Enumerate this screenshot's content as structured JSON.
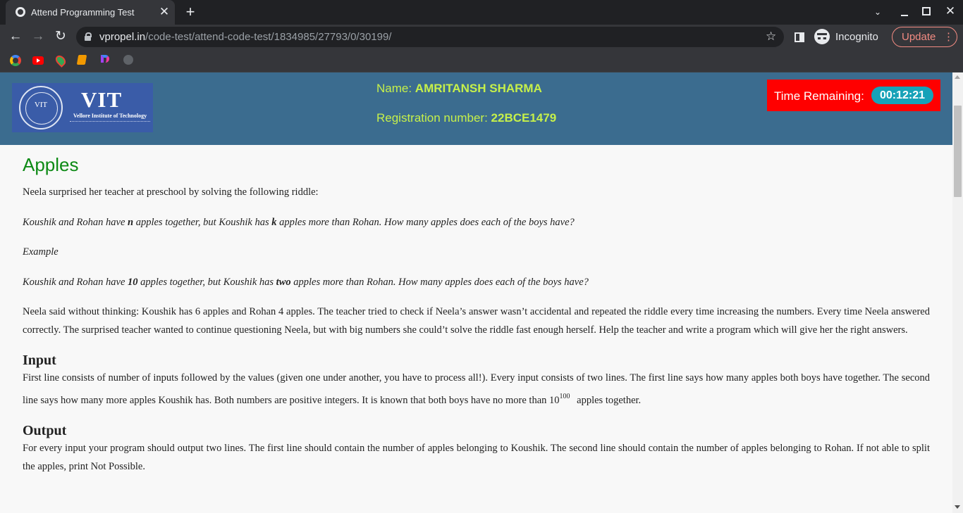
{
  "browser": {
    "tab_title": "Attend Programming Test",
    "tab_close": "✕",
    "new_tab": "+",
    "url_host": "vpropel.in",
    "url_path": "/code-test/attend-code-test/1834985/27793/0/30199/",
    "incognito_label": "Incognito",
    "update_label": "Update",
    "back": "←",
    "forward": "→",
    "reload": "↻",
    "star": "☆",
    "win_close": "✕",
    "tab_search": "⌄",
    "menu": "⋮"
  },
  "bookmarks": [
    "google-icon",
    "youtube-icon",
    "maps-icon",
    "books-icon",
    "p-app-icon",
    "globe-icon"
  ],
  "header": {
    "logo": {
      "seal": "VIT",
      "wordmark": "VIT",
      "fullname": "Vellore Institute of Technology"
    },
    "name_label": "Name: ",
    "name_value": "AMRITANSH SHARMA",
    "reg_label": "Registration number: ",
    "reg_value": "22BCE1479",
    "timer_label": "Time Remaining:",
    "timer_value": "00:12:21"
  },
  "problem": {
    "title": "Apples",
    "intro": "Neela surprised her teacher at preschool by solving the following riddle:",
    "riddle": {
      "a": "Koushik and Rohan have ",
      "n": "n",
      "b": " apples together, but Koushik has ",
      "k": "k",
      "c": " apples more than Rohan. How many apples does each of the boys have?"
    },
    "example_label": "Example",
    "example": {
      "a": "Koushik and Rohan have ",
      "n": "10",
      "b": " apples together, but Koushik has ",
      "k": "two",
      "c": " apples more than Rohan. How many apples does each of the boys have?"
    },
    "story": "Neela said without thinking: Koushik has 6 apples and Rohan 4 apples. The teacher tried to check if Neela’s answer wasn’t accidental and repeated the riddle every time increasing the numbers. Every time Neela answered correctly. The surprised teacher wanted to continue questioning Neela, but with big numbers she could’t solve the riddle fast enough herself. Help the teacher and write a program which will give her the right answers.",
    "input_heading": "Input",
    "input_text": "First line consists of number of inputs followed by the values (given one under another, you have to process all!). Every input consists of two lines. The first line says how many apples both boys have together. The second line says how many more apples Koushik has. Both numbers are positive integers. It is known that both boys have no more than 10",
    "input_sup": "100",
    "input_tail": " apples together.",
    "output_heading": "Output",
    "output_text": "For every input your program should output two lines. The first line should contain the number of apples belonging to Koushik. The second line should contain the number of apples belonging to Rohan. If not able to split the apples, print Not Possible."
  },
  "colors": {
    "header_bg": "#3b6c8f",
    "header_text": "#c6f04a",
    "timer_bg": "#ff0000",
    "timer_pill": "#17a2b8",
    "title_green": "#0e8a16"
  }
}
